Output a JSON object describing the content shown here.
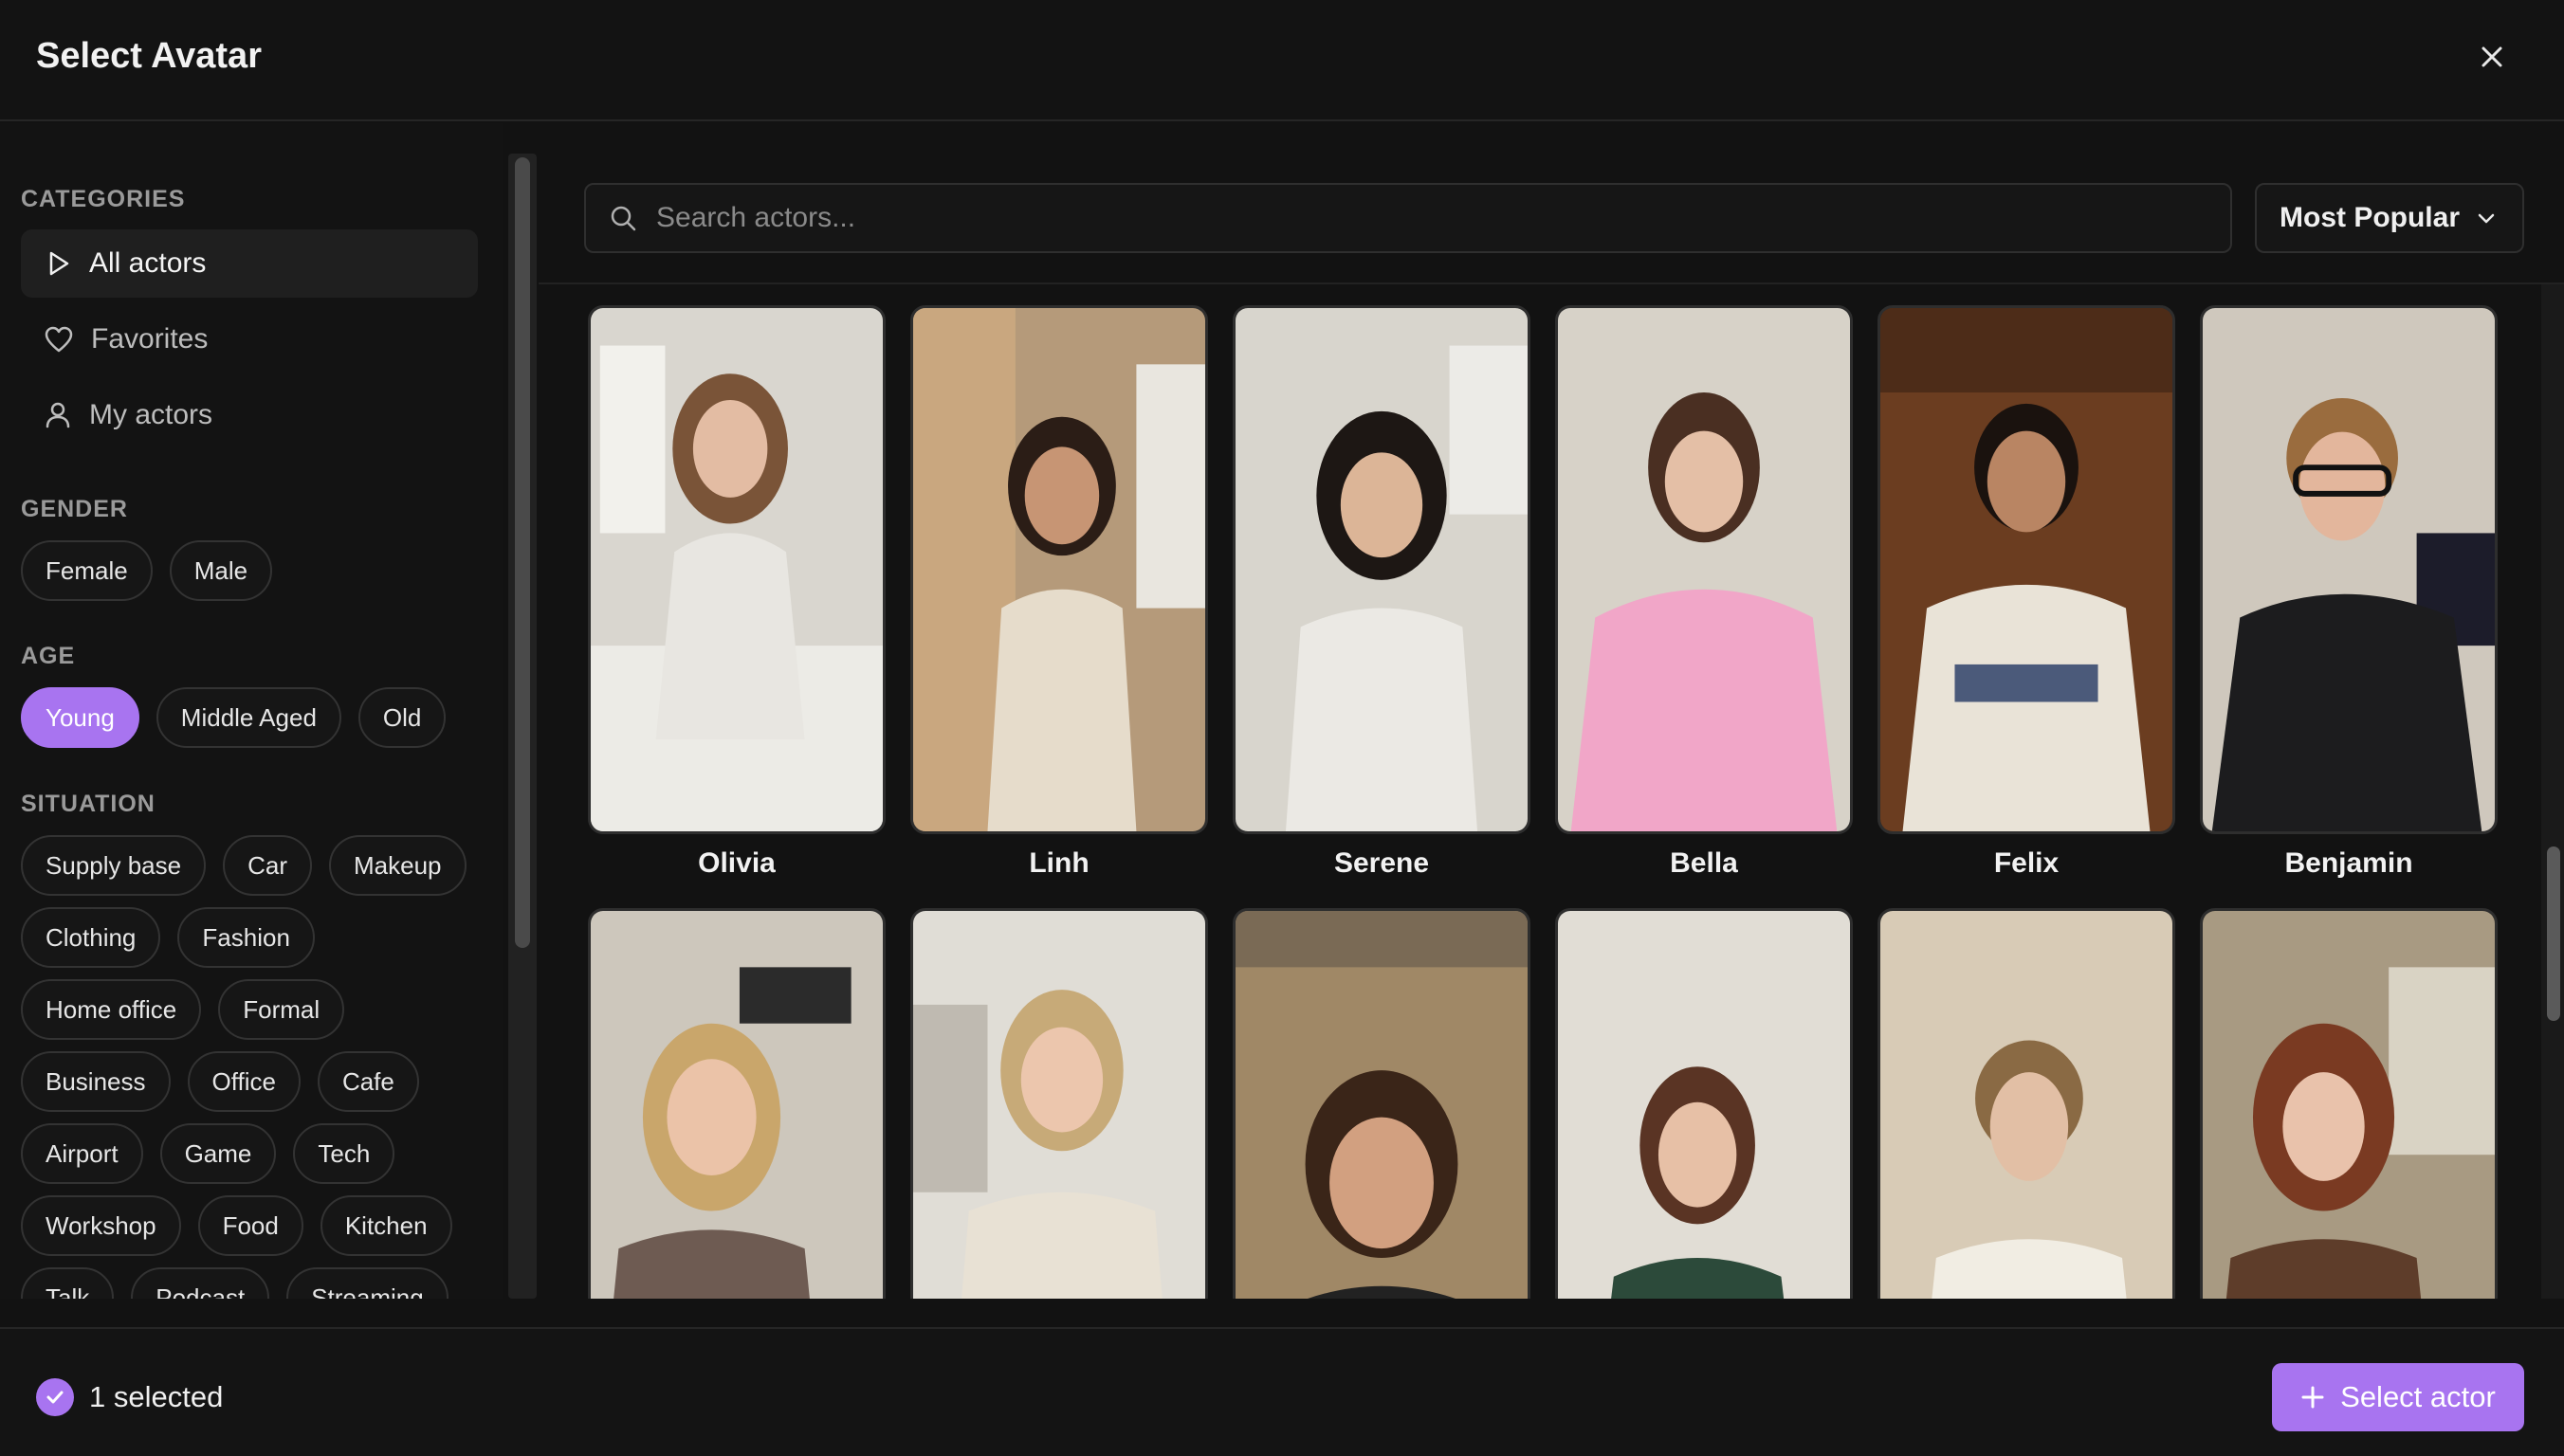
{
  "header": {
    "title": "Select Avatar"
  },
  "sidebar": {
    "categories_label": "CATEGORIES",
    "nav": [
      {
        "label": "All actors",
        "icon": "play-icon",
        "active": true
      },
      {
        "label": "Favorites",
        "icon": "heart-icon",
        "active": false
      },
      {
        "label": "My actors",
        "icon": "user-icon",
        "active": false
      }
    ],
    "gender_label": "GENDER",
    "gender": [
      "Female",
      "Male"
    ],
    "age_label": "AGE",
    "age": [
      "Young",
      "Middle Aged",
      "Old"
    ],
    "age_selected": "Young",
    "situation_label": "SITUATION",
    "situation_rows": [
      [
        "Supply base",
        "Car",
        "Makeup"
      ],
      [
        "Clothing",
        "Fashion"
      ],
      [
        "Home office",
        "Formal"
      ],
      [
        "Business",
        "Office",
        "Cafe"
      ],
      [
        "Airport",
        "Game",
        "Tech"
      ],
      [
        "Workshop",
        "Food",
        "Kitchen"
      ],
      [
        "Talk",
        "Podcast",
        "Streaming"
      ]
    ]
  },
  "search": {
    "placeholder": "Search actors...",
    "value": ""
  },
  "sort": {
    "label": "Most Popular"
  },
  "actors_row1": [
    {
      "name": "Olivia"
    },
    {
      "name": "Linh"
    },
    {
      "name": "Serene"
    },
    {
      "name": "Bella"
    },
    {
      "name": "Felix"
    },
    {
      "name": "Benjamin"
    }
  ],
  "actors_row2_count": 6,
  "footer": {
    "selected_text": "1 selected",
    "button_label": "Select actor"
  },
  "colors": {
    "accent": "#a874f0",
    "background": "#121212",
    "surface": "#161616",
    "border": "#2f2f2f"
  }
}
